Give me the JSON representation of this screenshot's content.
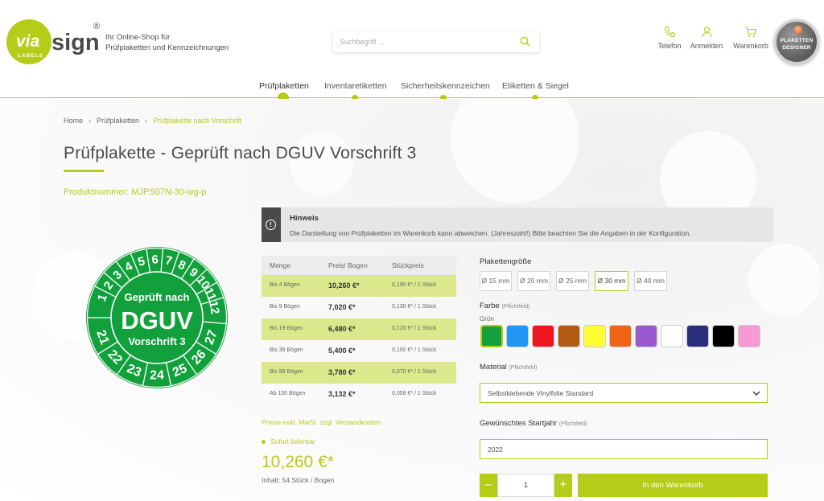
{
  "header": {
    "logo": {
      "via": "via",
      "sign": "sign",
      "labels": "LABELS",
      "reg": "®"
    },
    "tagline": [
      "Ihr Online-Shop für",
      "Prüfplaketten und Kennzeichnungen"
    ],
    "search_placeholder": "Suchbegriff ...",
    "icons": [
      {
        "label": "Telefon",
        "icon": "phone-icon"
      },
      {
        "label": "Anmelden",
        "icon": "user-icon"
      },
      {
        "label": "Warenkorb",
        "icon": "cart-icon"
      }
    ],
    "designer": [
      "PLAKETTEN",
      "DESIGNER"
    ],
    "nav": [
      "Prüfplaketten",
      "Inventaretiketten",
      "Sicherheitskennzeichen",
      "Etiketten & Siegel"
    ]
  },
  "breadcrumb": [
    "Home",
    "Prüfplaketten",
    "Prüfplakette nach Vorschrift"
  ],
  "title": "Prüfplakette - Geprüft nach DGUV Vorschrift 3",
  "product_number": "Produktnummer: MJPS07N-30-wg-p",
  "badge": {
    "line1": "Geprüft nach",
    "line2": "DGUV",
    "line3": "Vorschrift 3",
    "months": [
      "1",
      "2",
      "3",
      "4",
      "5",
      "6",
      "7",
      "8",
      "9",
      "10",
      "11",
      "12"
    ],
    "years": [
      "21",
      "22",
      "23",
      "24",
      "25",
      "26",
      "27"
    ],
    "color": "#12a03d"
  },
  "hint": {
    "heading": "Hinweis",
    "body": "Die Darstellung von Prüfplaketten im Warenkorb kann abweichen. (Jahreszahl!) Bitte beachten Sie die Angaben in der Konfiguration."
  },
  "price_table": {
    "headers": [
      "Menge",
      "Preis/ Bogen",
      "Stückpreis"
    ],
    "rows": [
      {
        "qty": "Bis 4 Bögen",
        "price": "10,260 €*",
        "unit": "0,190 €* / 1 Stück"
      },
      {
        "qty": "Bis 9 Bögen",
        "price": "7,020 €*",
        "unit": "0,130 €* / 1 Stück"
      },
      {
        "qty": "Bis 19 Bögen",
        "price": "6,480 €*",
        "unit": "0,120 €* / 1 Stück"
      },
      {
        "qty": "Bis 39 Bögen",
        "price": "5,400 €*",
        "unit": "0,100 €* / 1 Stück"
      },
      {
        "qty": "Bis 99 Bögen",
        "price": "3,780 €*",
        "unit": "0,070 €* / 1 Stück"
      },
      {
        "qty": "Ab 100 Bögen",
        "price": "3,132 €*",
        "unit": "0,058 €* / 1 Stück"
      }
    ]
  },
  "price_note": "Preise exkl. MwSt. zzgl. Versandkosten",
  "availability": "Sofort lieferbar",
  "price": "10,260 €*",
  "content": "Inhalt: 54 Stück / Bogen",
  "config": {
    "size_label": "Plakettengröße",
    "sizes": [
      "Ø 15 mm",
      "Ø 20 mm",
      "Ø 25 mm",
      "Ø 30 mm",
      "Ø 40 mm"
    ],
    "selected_size": "Ø 30 mm",
    "color_label": "Farbe",
    "required": "(Pflichtfeld)",
    "color_selected": "Grün",
    "colors": [
      "#14a03c",
      "#2196f3",
      "#f0141e",
      "#b35a10",
      "#ffff33",
      "#f06414",
      "#9b59d0",
      "#ffffff",
      "#2a2f7d",
      "#000000",
      "#f59ad2"
    ],
    "material_label": "Material",
    "material_value": "Selbstklebende Vinylfolie Standard",
    "year_label": "Gewünschtes Startjahr",
    "year_value": "2022",
    "quantity": "1",
    "minus": "–",
    "plus": "+",
    "add_to_cart": "In den Warenkorb"
  }
}
